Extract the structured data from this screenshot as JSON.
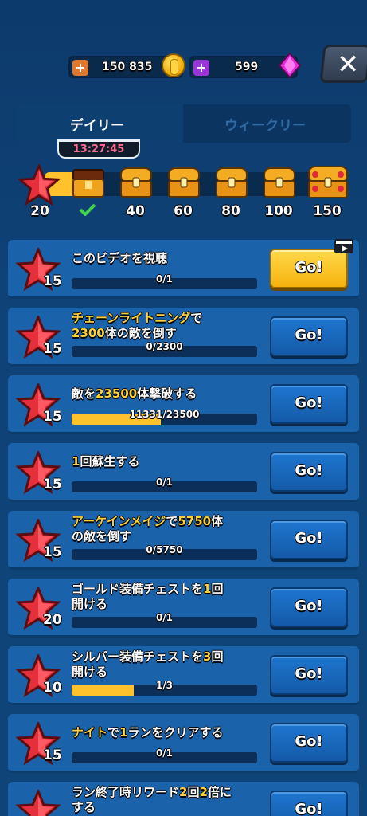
{
  "currencies": {
    "gold": {
      "value": "150 835",
      "icon": "coin-icon"
    },
    "gems": {
      "value": "599",
      "icon": "gem-icon"
    }
  },
  "tabs": {
    "daily": "デイリー",
    "weekly": "ウィークリー",
    "active": "daily"
  },
  "timer": "13:27:45",
  "milestones": {
    "current_points": "20",
    "values": [
      "40",
      "60",
      "80",
      "100",
      "150"
    ],
    "claimed": "check-icon"
  },
  "tasks": [
    {
      "points": "15",
      "title_parts": [
        "このビデオを視聴"
      ],
      "progress": "0/1",
      "fraction": 0,
      "go": "Go!",
      "highlight": true
    },
    {
      "points": "15",
      "line1": [
        "チェーンライトニング",
        "で"
      ],
      "line2": [
        "2300",
        "体の敵を倒す"
      ],
      "progress": "0/2300",
      "fraction": 0,
      "go": "Go!"
    },
    {
      "points": "15",
      "line1": [
        "敵を",
        "23500",
        "体撃破する"
      ],
      "progress": "11331/23500",
      "fraction": 0.482,
      "go": "Go!"
    },
    {
      "points": "15",
      "line1": [
        "1",
        "回蘇生する"
      ],
      "progress": "0/1",
      "fraction": 0,
      "go": "Go!"
    },
    {
      "points": "15",
      "line1": [
        "アーケインメイジ",
        "で",
        "5750",
        "体"
      ],
      "line2": [
        "の敵を倒す"
      ],
      "progress": "0/5750",
      "fraction": 0,
      "go": "Go!"
    },
    {
      "points": "20",
      "line1": [
        "ゴールド装備チェストを",
        "1",
        "回"
      ],
      "line2": [
        "開ける"
      ],
      "progress": "0/1",
      "fraction": 0,
      "go": "Go!"
    },
    {
      "points": "10",
      "line1": [
        "シルバー装備チェストを",
        "3",
        "回"
      ],
      "line2": [
        "開ける"
      ],
      "progress": "1/3",
      "fraction": 0.333,
      "go": "Go!"
    },
    {
      "points": "15",
      "line1": [
        "ナイト",
        "で",
        "1",
        "ランをクリアする"
      ],
      "progress": "0/1",
      "fraction": 0,
      "go": "Go!"
    },
    {
      "points": "",
      "line1": [
        "ラン終了時リワード",
        "2",
        "回",
        "2",
        "倍に"
      ],
      "line2": [
        "する"
      ],
      "progress": "",
      "fraction": 0,
      "go": "Go!"
    }
  ],
  "colors": {
    "accent": "#ffc12c",
    "highlight_text": "#ffd23a",
    "timer": "#ff6b8f",
    "card": "#1a63ab"
  }
}
